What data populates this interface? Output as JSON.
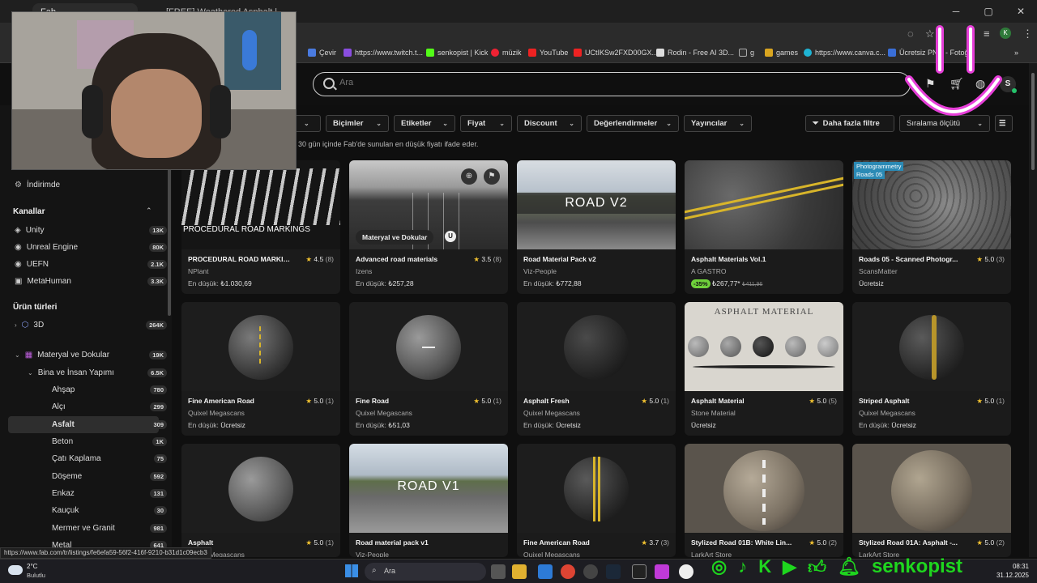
{
  "browser": {
    "tabs": [
      {
        "label": "Fab"
      },
      {
        "label": "[FREE] Weathered Asphalt | Fab"
      }
    ],
    "bookmarks": [
      {
        "label": "Çevir"
      },
      {
        "label": "https://www.twitch.t..."
      },
      {
        "label": "senkopist | Kick"
      },
      {
        "label": "müzik"
      },
      {
        "label": "YouTube"
      },
      {
        "label": "UCtIKSw2FXD00GX..."
      },
      {
        "label": "Rodin - Free AI 3D..."
      },
      {
        "label": "g"
      },
      {
        "label": "games"
      },
      {
        "label": "https://www.canva.c..."
      },
      {
        "label": "Ücretsiz PNG - Fotoğ..."
      }
    ],
    "profile_initial": "K"
  },
  "header": {
    "search_placeholder": "Ara",
    "avatar_initial": "S"
  },
  "filters": {
    "chips": [
      {
        "label": "Biçimler"
      },
      {
        "label": "Etiketler"
      },
      {
        "label": "Fiyat"
      },
      {
        "label": "Discount"
      },
      {
        "label": "Değerlendirmeler"
      },
      {
        "label": "Yayıncılar"
      }
    ],
    "more_filters": "Daha fazla filtre",
    "sort_label": "Sıralama ölçütü",
    "price_note": "30 gün içinde Fab'de sunulan en düşük fiyatı ifade eder."
  },
  "sidebar": {
    "discounted": "İndirimde",
    "channels_heading": "Kanallar",
    "channels": [
      {
        "label": "Unity",
        "count": "13K"
      },
      {
        "label": "Unreal Engine",
        "count": "80K"
      },
      {
        "label": "UEFN",
        "count": "2.1K"
      },
      {
        "label": "MetaHuman",
        "count": "3.3K"
      }
    ],
    "types_heading": "Ürün türleri",
    "types": [
      {
        "label": "3D",
        "count": "264K"
      }
    ],
    "materials": {
      "label": "Materyal ve Dokular",
      "count": "19K"
    },
    "building": {
      "label": "Bina ve İnsan Yapımı",
      "count": "6.5K"
    },
    "subitems": [
      {
        "label": "Ahşap",
        "count": "780"
      },
      {
        "label": "Alçı",
        "count": "299"
      },
      {
        "label": "Asfalt",
        "count": "309"
      },
      {
        "label": "Beton",
        "count": "1K"
      },
      {
        "label": "Çatı Kaplama",
        "count": "75"
      },
      {
        "label": "Döşeme",
        "count": "592"
      },
      {
        "label": "Enkaz",
        "count": "131"
      },
      {
        "label": "Kauçuk",
        "count": "30"
      },
      {
        "label": "Mermer ve Granit",
        "count": "981"
      },
      {
        "label": "Metal",
        "count": "641"
      }
    ]
  },
  "products": [
    {
      "title": "PROCEDURAL ROAD MARKIN...",
      "rating": "4.5",
      "count": "(8)",
      "seller": "NPlant",
      "price_label": "En düşük:",
      "price": "₺1.030,69",
      "thumb_text": "PROCEDURAL ROAD MARKINGS"
    },
    {
      "title": "Advanced road materials",
      "rating": "3.5",
      "count": "(8)",
      "seller": "Izens",
      "price_label": "En düşük:",
      "price": "₺257,28",
      "badge": "Materyal ve Dokular"
    },
    {
      "title": "Road Material Pack v2",
      "seller": "Viz-People",
      "price_label": "En düşük:",
      "price": "₺772,88",
      "thumb_text": "ROAD V2"
    },
    {
      "title": "Asphalt Materials Vol.1",
      "seller": "A GASTRO",
      "discount": "-35%",
      "price": "₺267,77*",
      "old_price": "₺411,96"
    },
    {
      "title": "Roads 05 - Scanned Photogr...",
      "rating": "5.0",
      "count": "(3)",
      "seller": "ScansMatter",
      "price": "Ücretsiz",
      "tag1": "Photogrammetry",
      "tag2": "Roads 05"
    },
    {
      "title": "Fine American Road",
      "rating": "5.0",
      "count": "(1)",
      "seller": "Quixel Megascans",
      "price_label": "En düşük:",
      "price": "Ücretsiz"
    },
    {
      "title": "Fine Road",
      "rating": "5.0",
      "count": "(1)",
      "seller": "Quixel Megascans",
      "price_label": "En düşük:",
      "price": "₺51,03"
    },
    {
      "title": "Asphalt Fresh",
      "rating": "5.0",
      "count": "(1)",
      "seller": "Quixel Megascans",
      "price_label": "En düşük:",
      "price": "Ücretsiz"
    },
    {
      "title": "Asphalt Material",
      "rating": "5.0",
      "count": "(5)",
      "seller": "Stone Material",
      "price": "Ücretsiz",
      "thumb_text": "ASPHALT MATERIAL"
    },
    {
      "title": "Striped Asphalt",
      "rating": "5.0",
      "count": "(1)",
      "seller": "Quixel Megascans",
      "price_label": "En düşük:",
      "price": "Ücretsiz"
    },
    {
      "title": "Asphalt",
      "rating": "5.0",
      "count": "(1)",
      "seller": "Quixel Megascans"
    },
    {
      "title": "Road material pack v1",
      "seller": "Viz-People",
      "thumb_text": "ROAD V1"
    },
    {
      "title": "Fine American Road",
      "rating": "3.7",
      "count": "(3)",
      "seller": "Quixel Megascans"
    },
    {
      "title": "Stylized Road 01B: White Lin...",
      "rating": "5.0",
      "count": "(2)",
      "seller": "LarkArt Store"
    },
    {
      "title": "Stylized Road 01A: Asphalt -...",
      "rating": "5.0",
      "count": "(2)",
      "seller": "LarkArt Store"
    }
  ],
  "status_url": "https://www.fab.com/tr/listings/fe6efa59-56f2-416f-9210-b31d1c09ecb3",
  "taskbar": {
    "weather_temp": "2°C",
    "weather_desc": "Bulutlu",
    "search": "Ara",
    "time": "08:31",
    "date": "31.12.2025"
  },
  "overlay": {
    "brand": "senkopist"
  },
  "colors": {
    "accent_star": "#f2c230",
    "discount": "#6fd13b",
    "online": "#25c26b"
  }
}
